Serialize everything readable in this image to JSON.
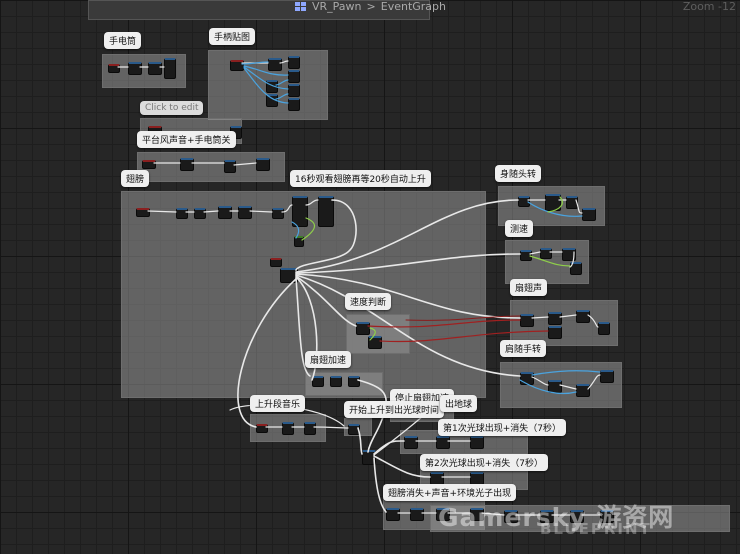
{
  "editor": {
    "graph_name": "VR_Pawn",
    "separator": ">",
    "graph_tab": "EventGraph",
    "zoom": "Zoom -12"
  },
  "comments": {
    "flashlight": "手电筒",
    "controller_texture": "手柄贴图",
    "click_to_edit": "Click to edit",
    "wind_sound": "平台风声音+手电筒关",
    "wings": "翅膀",
    "wing_timer": "16秒观看翅膀再等20秒自动上升",
    "body_turn": "身随头转",
    "speed_test": "测速",
    "speed_judge": "速度判断",
    "flap_sound": "扇翅声",
    "flap_accel": "扇翅加速",
    "shoulder_turn": "肩随手转",
    "ascend_music": "上升段音乐",
    "stop_flap": "停止扇翅加速",
    "ascend_start": "开始上升到出光球时间",
    "earth_appear": "出地球",
    "orb_first": "第1次光球出现+消失（7秒）",
    "orb_second": "第2次光球出现+消失（7秒）",
    "wings_vanish": "翅膀消失+声音+环境光子出现"
  },
  "watermark": {
    "main": "Gamersky 游资网",
    "sub": "BLUEPRINT"
  },
  "colors": {
    "exec_wire": "#e8e8e8",
    "data_wire_blue": "#4aa3df",
    "data_wire_green": "#8fcf4a",
    "data_wire_red": "#a02020",
    "comment_box": "#8f8f8f",
    "grid_bg": "#262626"
  }
}
